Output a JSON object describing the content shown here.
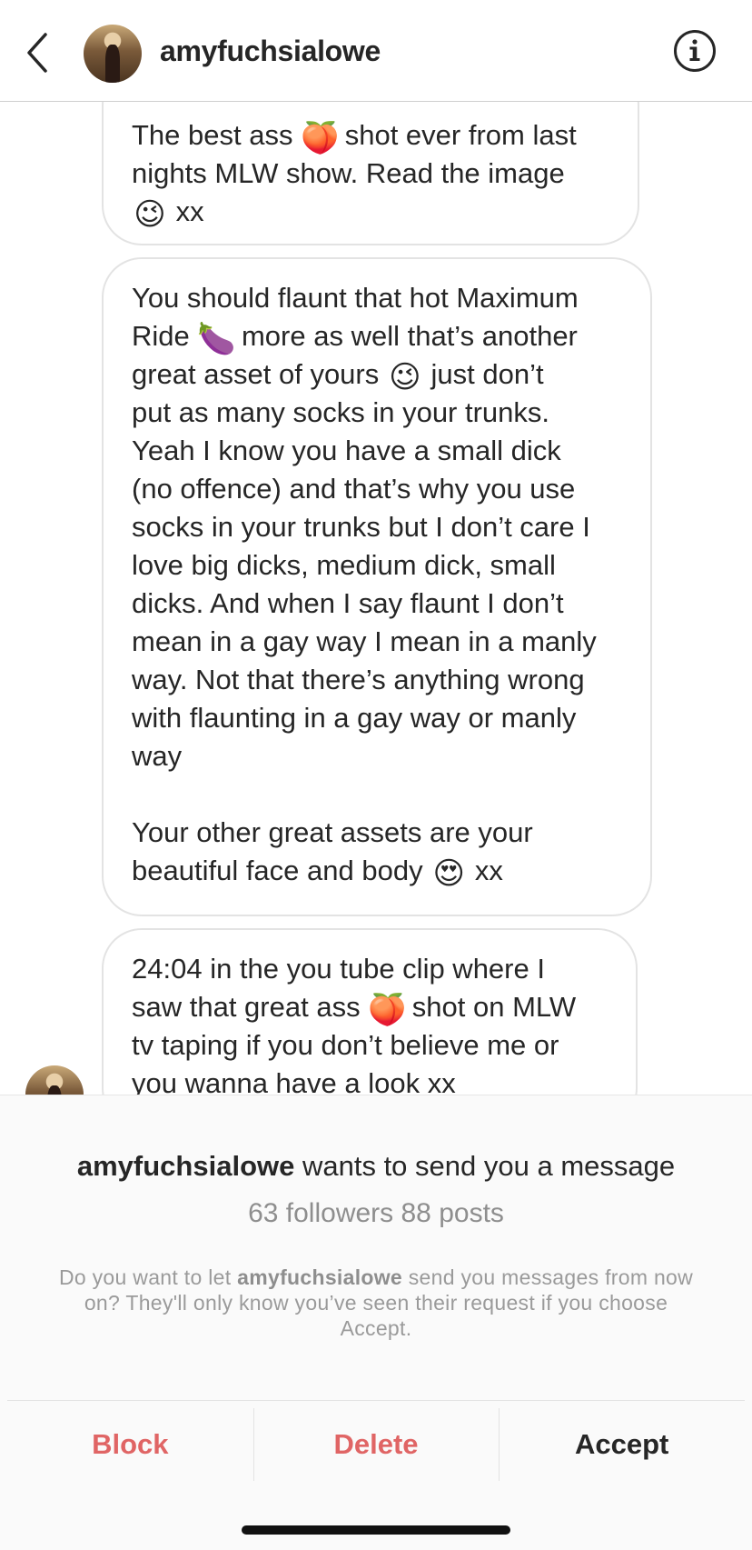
{
  "header": {
    "username": "amyfuchsialowe",
    "back_icon": "chevron-left-icon",
    "info_icon": "info-circle-icon"
  },
  "messages": [
    {
      "parts": [
        "The best ass ",
        "🍑",
        " shot ever from last\nnights MLW show. Read the image\n",
        "😉",
        " xx"
      ]
    },
    {
      "parts": [
        "You should flaunt that hot Maximum\nRide ",
        "🍆",
        " more as well that’s another\ngreat asset of yours ",
        "😉",
        " just don’t\nput as many socks in your trunks.\nYeah I know you have a small dick\n(no offence) and that’s why you use\nsocks in your trunks but I don’t care I\nlove big dicks, medium dick, small\ndicks. And when I say flaunt I don’t\nmean in a gay way I mean in a manly\nway. Not that there’s anything wrong\nwith flaunting in a gay way or manly\nway\n\nYour other great assets are your\nbeautiful face and body ",
        "😍",
        " xx"
      ]
    },
    {
      "parts": [
        "24:04 in the you tube clip where I\nsaw that great ass ",
        "🍑",
        " shot on MLW\ntv taping if you don’t believe me or\nyou wanna have a look xx"
      ]
    }
  ],
  "request": {
    "username": "amyfuchsialowe",
    "title_suffix": " wants to send you a message",
    "stats": "63 followers 88 posts",
    "desc_prefix": "Do you want to let ",
    "desc_username": "amyfuchsialowe",
    "desc_suffix": " send you messages from now on? They'll only know you’ve seen their request if you choose Accept."
  },
  "actions": {
    "block": "Block",
    "delete": "Delete",
    "accept": "Accept"
  },
  "colors": {
    "destructive": "#e06565",
    "text": "#262626",
    "muted": "#8e8e8e"
  }
}
